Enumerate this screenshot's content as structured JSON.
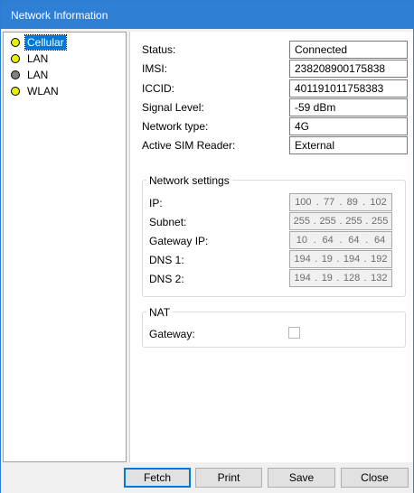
{
  "window": {
    "title": "Network Information"
  },
  "tree": {
    "items": [
      {
        "label": "Cellular",
        "dot_color": "#e6f000",
        "selected": true
      },
      {
        "label": "LAN",
        "dot_color": "#e6f000",
        "selected": false
      },
      {
        "label": "LAN",
        "dot_color": "#808080",
        "selected": false
      },
      {
        "label": "WLAN",
        "dot_color": "#e6f000",
        "selected": false
      }
    ]
  },
  "status": {
    "status_label": "Status:",
    "status_value": "Connected",
    "imsi_label": "IMSI:",
    "imsi_value": "238208900175838",
    "iccid_label": "ICCID:",
    "iccid_value": "401191011758383",
    "signal_label": "Signal Level:",
    "signal_value": "-59 dBm",
    "network_type_label": "Network type:",
    "network_type_value": "4G",
    "sim_reader_label": "Active SIM Reader:",
    "sim_reader_value": "External"
  },
  "network_settings": {
    "title": "Network settings",
    "ip": {
      "label": "IP:",
      "octets": [
        "100",
        "77",
        "89",
        "102"
      ]
    },
    "subnet": {
      "label": "Subnet:",
      "octets": [
        "255",
        "255",
        "255",
        "255"
      ]
    },
    "gateway": {
      "label": "Gateway IP:",
      "octets": [
        "10",
        "64",
        "64",
        "64"
      ]
    },
    "dns1": {
      "label": "DNS 1:",
      "octets": [
        "194",
        "19",
        "194",
        "192"
      ]
    },
    "dns2": {
      "label": "DNS 2:",
      "octets": [
        "194",
        "19",
        "128",
        "132"
      ]
    },
    "dot": "."
  },
  "nat": {
    "title": "NAT",
    "gateway_label": "Gateway:",
    "gateway_checked": false
  },
  "buttons": {
    "fetch": "Fetch",
    "print": "Print",
    "save": "Save",
    "close": "Close"
  },
  "colors": {
    "titlebar": "#2f7fd5",
    "selection": "#0078d7"
  }
}
